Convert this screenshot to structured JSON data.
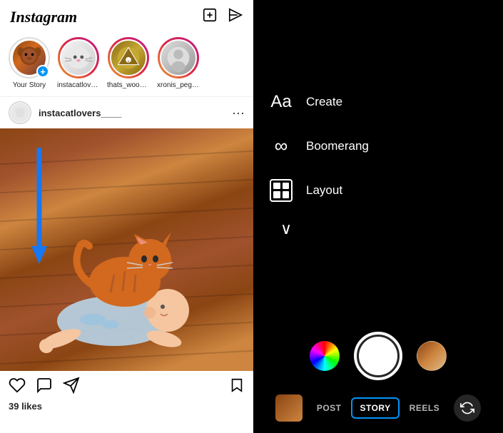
{
  "app": {
    "name": "Instagram"
  },
  "header": {
    "logo": "Instagram",
    "icons": {
      "new_post": "⊕",
      "messages": "▷"
    }
  },
  "stories": [
    {
      "id": "your_story",
      "label": "Your Story",
      "type": "your"
    },
    {
      "id": "instacatlovers",
      "label": "instacatlovers...",
      "type": "cat"
    },
    {
      "id": "thats_wood",
      "label": "thats_wood_...",
      "type": "wood"
    },
    {
      "id": "xronis_pegk",
      "label": "xronis_pegk_...",
      "type": "person"
    }
  ],
  "post": {
    "username": "instacatlovers____",
    "likes": "39 likes"
  },
  "actions": {
    "like": "♡",
    "comment": "💬",
    "share": "▷",
    "bookmark": "🔖"
  },
  "camera": {
    "menu": [
      {
        "id": "create",
        "label": "Create",
        "icon": "Aa"
      },
      {
        "id": "boomerang",
        "label": "Boomerang",
        "icon": "∞"
      },
      {
        "id": "layout",
        "label": "Layout",
        "icon": "layout"
      }
    ],
    "chevron": "∨"
  },
  "modes": [
    {
      "id": "post",
      "label": "POST",
      "active": false
    },
    {
      "id": "story",
      "label": "STORY",
      "active": true
    },
    {
      "id": "reels",
      "label": "REELS",
      "active": false
    }
  ]
}
